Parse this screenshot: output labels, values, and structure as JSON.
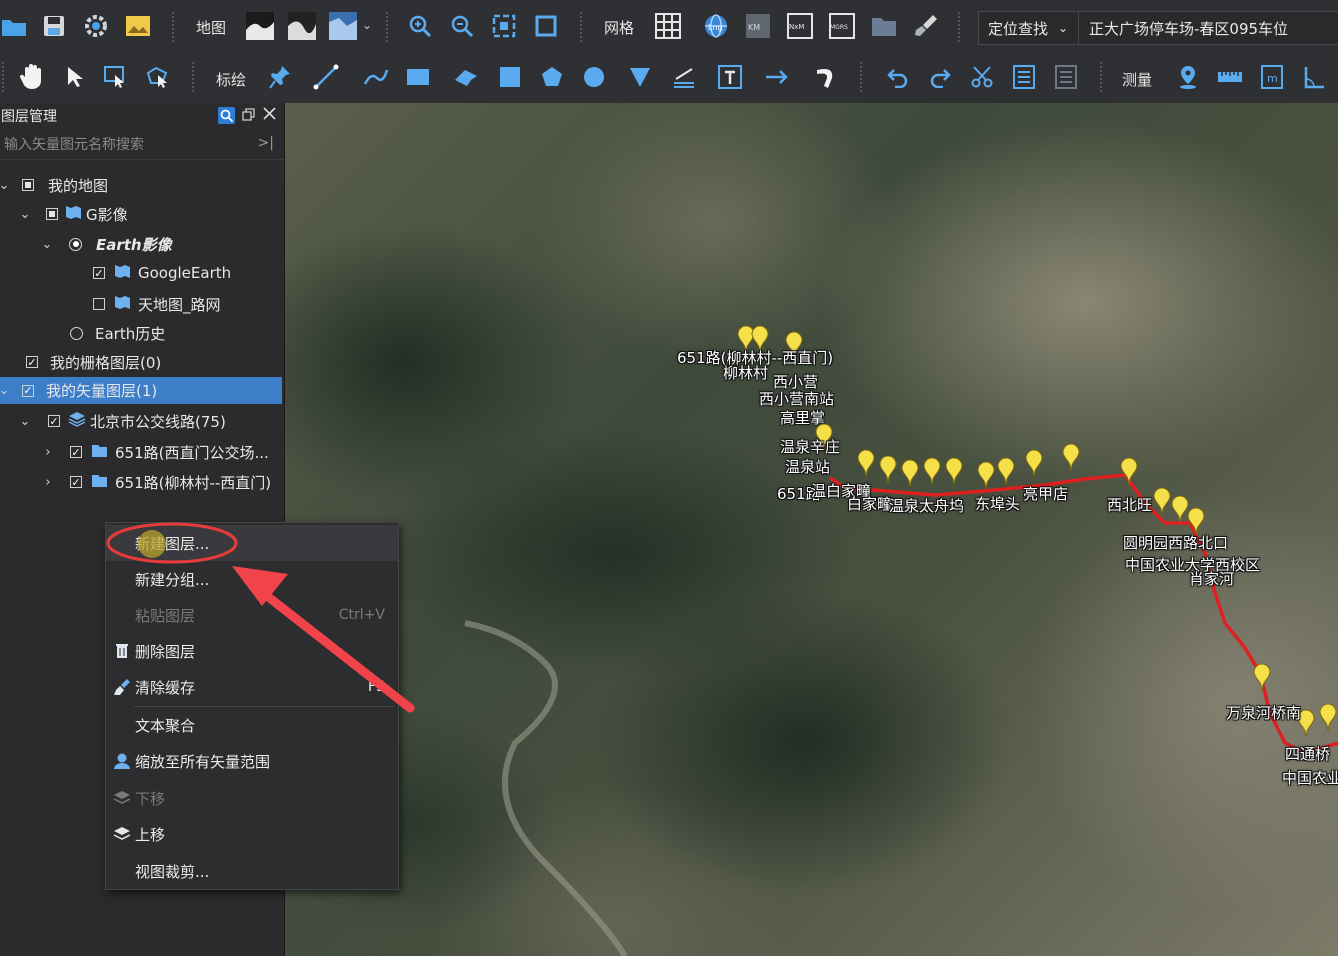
{
  "toolbar1": {
    "map_label": "地图",
    "grid_label": "网格",
    "mini_labels": {
      "km": "KM",
      "nxm": "NxM",
      "mgrs": "MGRS",
      "lng": "Lng"
    },
    "locate_dropdown": "定位查找",
    "locate_value": "正大广场停车场-春区095车位"
  },
  "toolbar2": {
    "annotate_label": "标绘",
    "measure_label": "测量"
  },
  "layer_panel": {
    "title": "图层管理",
    "search_placeholder": "输入矢量图元名称搜索",
    "tree": [
      {
        "label": "我的地图"
      },
      {
        "label": "G影像"
      },
      {
        "label": "Earth影像"
      },
      {
        "label": "GoogleEarth"
      },
      {
        "label": "天地图_路网"
      },
      {
        "label": "Earth历史"
      },
      {
        "label": "我的栅格图层(0)"
      },
      {
        "label": "我的矢量图层(1)"
      },
      {
        "label": "北京市公交线路(75)"
      },
      {
        "label": "651路(西直门公交场..."
      },
      {
        "label": "651路(柳林村--西直门)"
      }
    ]
  },
  "context_menu": {
    "items": [
      {
        "label": "新建图层...",
        "shortcut": ""
      },
      {
        "label": "新建分组...",
        "shortcut": ""
      },
      {
        "label": "粘贴图层",
        "shortcut": "Ctrl+V"
      },
      {
        "label": "删除图层",
        "shortcut": ""
      },
      {
        "label": "清除缓存",
        "shortcut": "F5"
      },
      {
        "label": "文本聚合",
        "shortcut": ""
      },
      {
        "label": "缩放至所有矢量范围",
        "shortcut": ""
      },
      {
        "label": "下移",
        "shortcut": ""
      },
      {
        "label": "上移",
        "shortcut": ""
      },
      {
        "label": "视图裁剪...",
        "shortcut": ""
      }
    ]
  },
  "map_labels": [
    "651路(柳林村--西直门)",
    "柳林村",
    "西小营",
    "西小营南站",
    "高里掌",
    "温泉辛庄",
    "温泉站",
    "651路",
    "温白家疃",
    "白家疃",
    "温泉太舟坞",
    "东埠头",
    "亮甲店",
    "西北旺",
    "圆明园西路北口",
    "中国农业大学西校区",
    "肖家河",
    "万泉河桥南",
    "四通桥",
    "中国农业"
  ],
  "colors": {
    "accent": "#3d7ec9",
    "route": "#e02020",
    "pin": "#f5e04a",
    "annotation": "#e83b3b"
  }
}
